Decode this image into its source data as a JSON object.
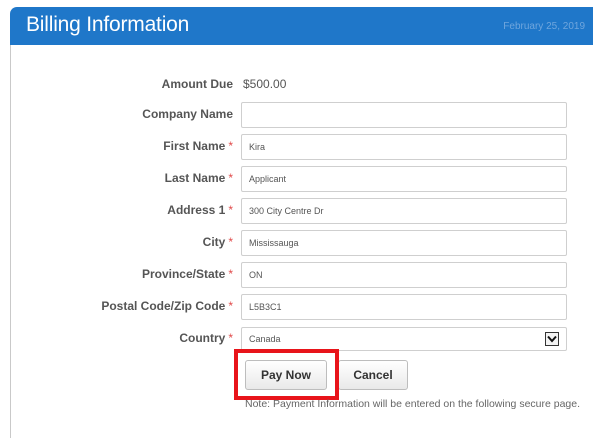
{
  "header": {
    "title": "Billing Information",
    "date": "February 25, 2019",
    "color": "#1f77c9"
  },
  "form": {
    "amount_due": {
      "label": "Amount Due",
      "value": "$500.00"
    },
    "company_name": {
      "label": "Company Name",
      "value": "",
      "required": false
    },
    "first_name": {
      "label": "First Name",
      "value": "Kira",
      "required": true
    },
    "last_name": {
      "label": "Last Name",
      "value": "Applicant",
      "required": true
    },
    "address1": {
      "label": "Address 1",
      "value": "300 City Centre Dr",
      "required": true
    },
    "city": {
      "label": "City",
      "value": "Mississauga",
      "required": true
    },
    "province": {
      "label": "Province/State",
      "value": "ON",
      "required": true
    },
    "postal": {
      "label": "Postal Code/Zip Code",
      "value": "L5B3C1",
      "required": true
    },
    "country": {
      "label": "Country",
      "value": "Canada",
      "required": true
    },
    "required_marker": "*"
  },
  "actions": {
    "pay_now": "Pay Now",
    "cancel": "Cancel",
    "highlight_color": "#e8141a"
  },
  "note": "Note: Payment Information will be entered on the following secure page."
}
